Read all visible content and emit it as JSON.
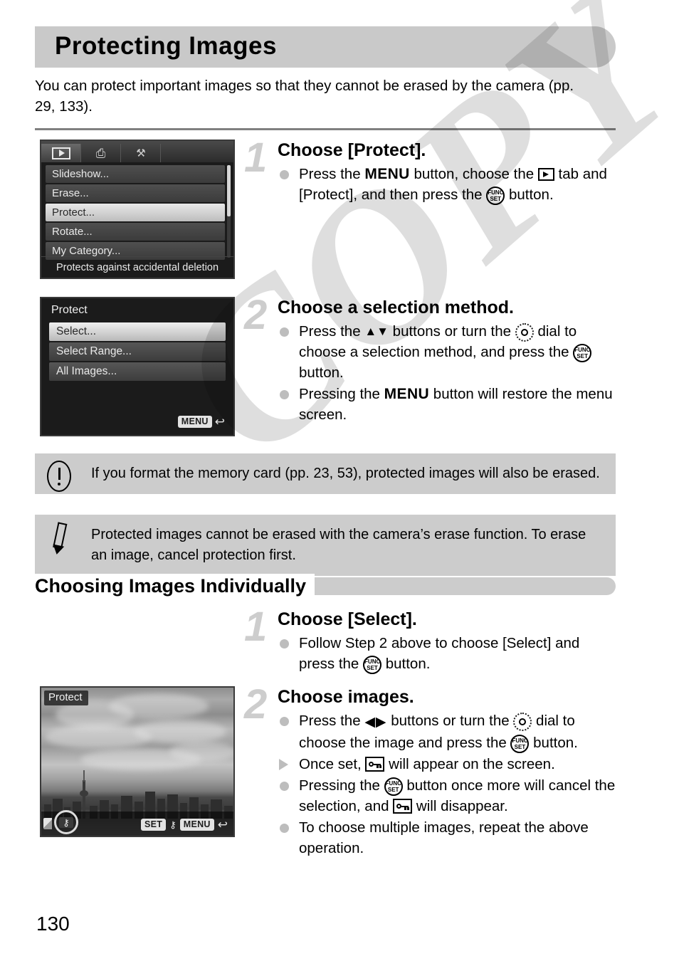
{
  "page": {
    "title": "Protecting Images",
    "intro": "You can protect important images so that they cannot be erased by the camera (pp. 29, 133).",
    "page_number": "130",
    "watermark": "COPY"
  },
  "screens": {
    "playback_menu": {
      "tabs": [
        {
          "name": "playback-tab",
          "icon": "play-icon",
          "active": true
        },
        {
          "name": "print-tab",
          "icon": "printer-icon",
          "active": false
        },
        {
          "name": "settings-tab",
          "icon": "tools-icon",
          "active": false
        }
      ],
      "items": [
        {
          "label": "Slideshow...",
          "selected": false
        },
        {
          "label": "Erase...",
          "selected": false
        },
        {
          "label": "Protect...",
          "selected": true
        },
        {
          "label": "Rotate...",
          "selected": false
        },
        {
          "label": "My Category...",
          "selected": false
        }
      ],
      "hint": "Protects against accidental deletion"
    },
    "protect_method": {
      "title": "Protect",
      "items": [
        {
          "label": "Select...",
          "selected": true
        },
        {
          "label": "Select Range...",
          "selected": false
        },
        {
          "label": "All Images...",
          "selected": false
        }
      ],
      "menu_badge": "MENU"
    },
    "photo_select": {
      "label": "Protect",
      "set_badge": "SET",
      "menu_badge": "MENU"
    }
  },
  "steps": [
    {
      "number": "1",
      "heading": "Choose [Protect].",
      "lines": {
        "l1a": "Press the",
        "l1b": "button, choose the",
        "l1c": "tab and [Protect], and then press the",
        "l1d": "button."
      }
    },
    {
      "number": "2",
      "heading": "Choose a selection method.",
      "lines": {
        "l1a": "Press the",
        "l1b": "buttons or turn the",
        "l1c": "dial to choose a selection method, and press the",
        "l1d": "button.",
        "l2a": "Pressing the",
        "l2b": "button will restore the menu screen."
      }
    },
    {
      "number": "1",
      "heading": "Choose [Select].",
      "lines": {
        "l1a": "Follow Step 2 above to choose [Select] and press the",
        "l1b": "button."
      }
    },
    {
      "number": "2",
      "heading": "Choose images.",
      "lines": {
        "l1a": "Press the",
        "l1b": "buttons or turn the",
        "l1c": "dial to choose the image and press the",
        "l1d": "button.",
        "l2a": "Once set,",
        "l2b": "will appear on the screen.",
        "l3a": "Pressing the",
        "l3b": "button once more will cancel the selection, and",
        "l3c": "will disappear.",
        "l4a": "To choose multiple images, repeat the above operation."
      }
    }
  ],
  "notes": [
    {
      "icon": "caution-icon",
      "text": "If you format the memory card (pp. 23, 53), protected images will also be erased."
    },
    {
      "icon": "pencil-icon",
      "text": "Protected images cannot be erased with the camera’s erase function. To erase an image, cancel protection first."
    }
  ],
  "section": {
    "heading": "Choosing Images Individually"
  },
  "glyphs": {
    "menu": "MENU",
    "func_line1": "FUNC.",
    "func_line2": "SET",
    "up_down": "▲▼",
    "left_right": "◀▶",
    "return_arrow": "↩",
    "printer": "⎙",
    "tools": "⚒"
  },
  "colors": {
    "title_bar": "#c9c9c9",
    "note_bg": "#cccccc",
    "step_number": "#cdcdcd",
    "bullet": "#bdbdbd",
    "rule": "#808080",
    "screen_bg": "#1b1b1b"
  }
}
